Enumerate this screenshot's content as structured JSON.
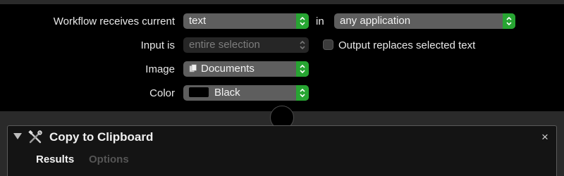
{
  "workflow": {
    "receives_label": "Workflow receives current",
    "receives_value": "text",
    "in_label": "in",
    "app_value": "any application",
    "input_is_label": "Input is",
    "input_is_value": "entire selection",
    "output_replaces_label": "Output replaces selected text",
    "output_replaces_checked": false,
    "image_label": "Image",
    "image_value": "Documents",
    "color_label": "Color",
    "color_value": "Black",
    "color_swatch": "#000000"
  },
  "action": {
    "title": "Copy to Clipboard",
    "tabs": [
      "Results",
      "Options"
    ],
    "icon": "tools-icon",
    "close": "×"
  },
  "colors": {
    "stepper_green": "#27a532",
    "popup_bg": "#5e5e5e"
  }
}
